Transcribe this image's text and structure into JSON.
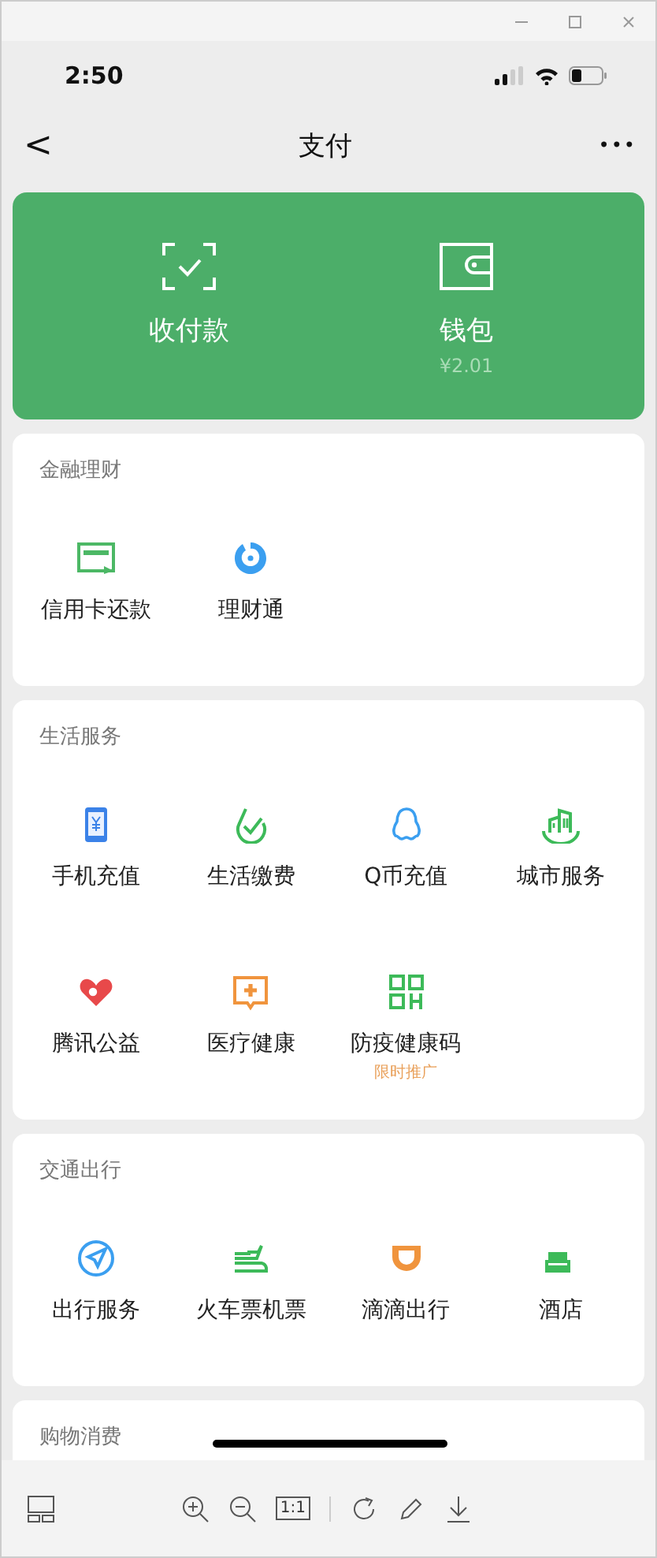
{
  "status_bar": {
    "time": "2:50"
  },
  "nav": {
    "back": "<",
    "title": "支付",
    "more": "•••"
  },
  "top_panel": {
    "items": [
      {
        "label": "收付款"
      },
      {
        "label": "钱包",
        "amount": "¥2.01"
      }
    ]
  },
  "sections": [
    {
      "title": "金融理财",
      "items": [
        {
          "label": "信用卡还款"
        },
        {
          "label": "理财通"
        }
      ]
    },
    {
      "title": "生活服务",
      "items": [
        {
          "label": "手机充值"
        },
        {
          "label": "生活缴费"
        },
        {
          "label": "Q币充值"
        },
        {
          "label": "城市服务"
        },
        {
          "label": "腾讯公益"
        },
        {
          "label": "医疗健康"
        },
        {
          "label": "防疫健康码",
          "badge": "限时推广"
        }
      ]
    },
    {
      "title": "交通出行",
      "items": [
        {
          "label": "出行服务"
        },
        {
          "label": "火车票机票"
        },
        {
          "label": "滴滴出行"
        },
        {
          "label": "酒店"
        }
      ]
    },
    {
      "title": "购物消费"
    }
  ],
  "viewer_toolbar": {
    "actual_size": "1:1"
  }
}
